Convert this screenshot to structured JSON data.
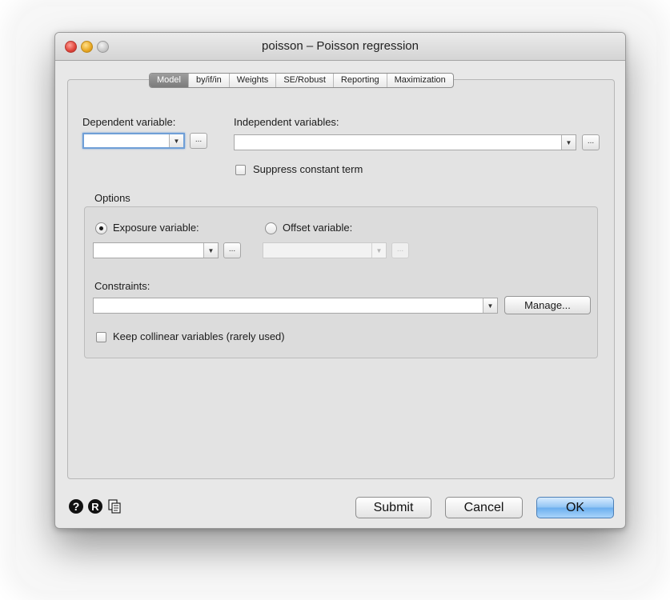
{
  "window": {
    "title": "poisson – Poisson regression"
  },
  "tabs": [
    {
      "label": "Model",
      "selected": true
    },
    {
      "label": "by/if/in",
      "selected": false
    },
    {
      "label": "Weights",
      "selected": false
    },
    {
      "label": "SE/Robust",
      "selected": false
    },
    {
      "label": "Reporting",
      "selected": false
    },
    {
      "label": "Maximization",
      "selected": false
    }
  ],
  "model": {
    "dependent_label": "Dependent variable:",
    "dependent_value": "",
    "independent_label": "Independent variables:",
    "independent_value": "",
    "browse_label": "...",
    "suppress_label": "Suppress constant term",
    "suppress_checked": false
  },
  "options": {
    "title": "Options",
    "exposure_label": "Exposure variable:",
    "exposure_selected": true,
    "exposure_value": "",
    "offset_label": "Offset variable:",
    "offset_selected": false,
    "offset_value": "",
    "constraints_label": "Constraints:",
    "constraints_value": "",
    "manage_label": "Manage...",
    "collinear_label": "Keep collinear variables (rarely used)",
    "collinear_checked": false
  },
  "footer": {
    "help_icon": "question-icon",
    "reset_icon": "reset-r-icon",
    "copy_icon": "copy-command-icon",
    "submit_label": "Submit",
    "cancel_label": "Cancel",
    "ok_label": "OK"
  },
  "colors": {
    "focus_ring": "#6f9fd7",
    "default_button": "#7fb9f2",
    "close": "#e0443a",
    "minimize": "#e8a722",
    "zoom": "#c9c9c9"
  }
}
